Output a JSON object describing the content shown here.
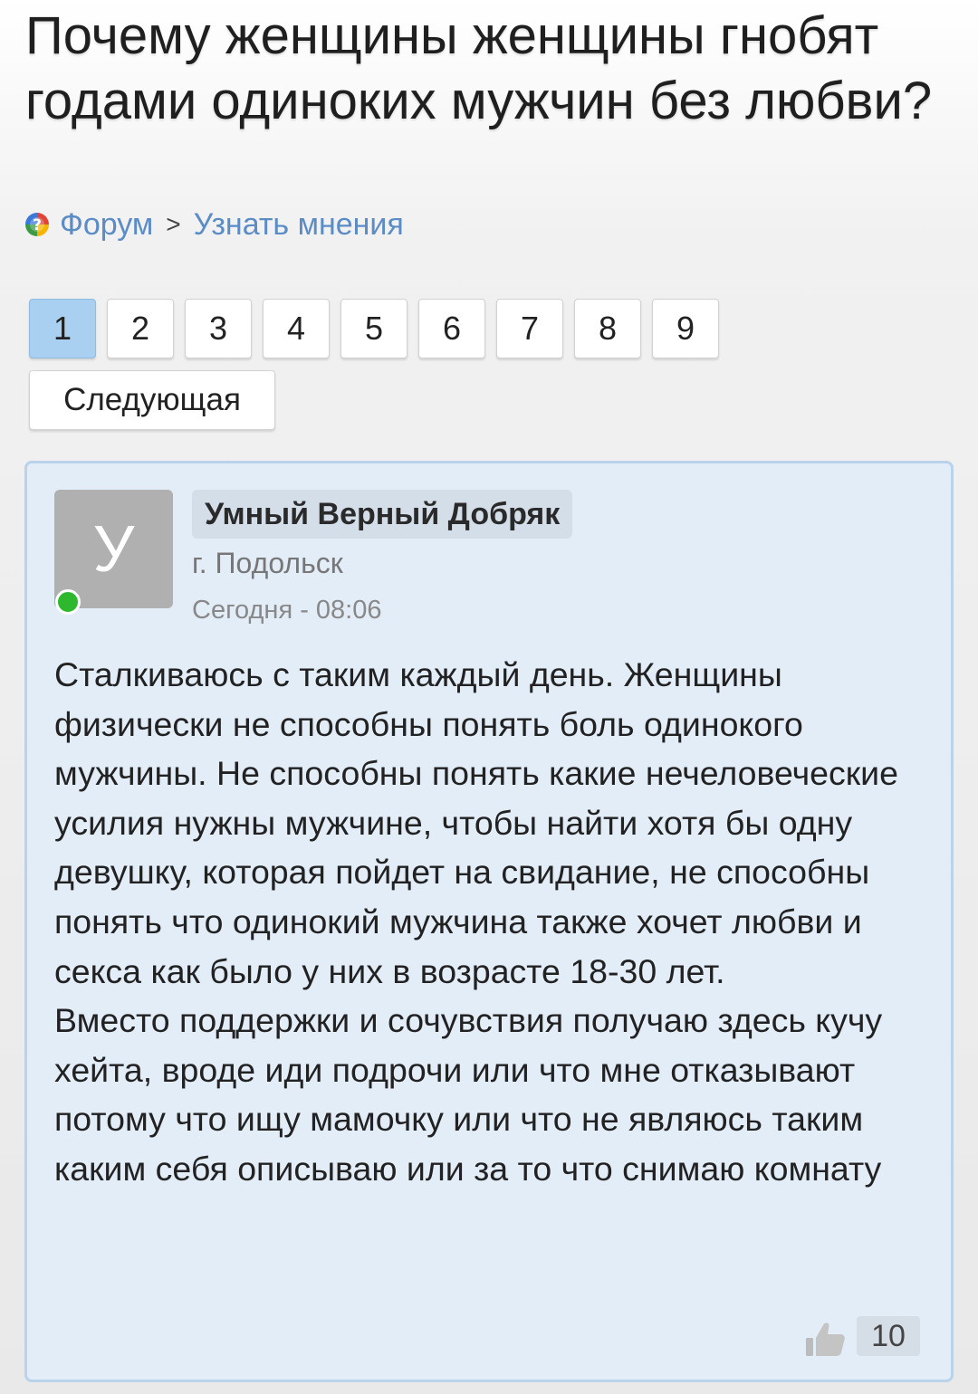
{
  "page": {
    "title": "Почему женщины женщины гнобят годами одиноких мужчин без любви?"
  },
  "breadcrumb": {
    "icon": "help-question-icon",
    "items": [
      "Форум",
      "Узнать мнения"
    ],
    "separator": ">"
  },
  "pagination": {
    "pages": [
      "1",
      "2",
      "3",
      "4",
      "5",
      "6",
      "7",
      "8",
      "9"
    ],
    "current": "1",
    "next_label": "Следующая"
  },
  "post": {
    "author": {
      "avatar_letter": "У",
      "name": "Умный Верный Добряк",
      "city": "г. Подольск",
      "online": true
    },
    "date": "Сегодня - 08:06",
    "text": "Сталкиваюсь с таким каждый день. Женщины физически не способны понять боль одинокого мужчины. Не способны понять какие нечеловеческие усилия нужны мужчине, чтобы найти хотя бы одну девушку, которая пойдет на свидание, не способны понять что одинокий мужчина также хочет любви и секса как было у них в возрасте 18-30 лет.\nВместо поддержки и сочувствия получаю здесь кучу хейта, вроде иди подрочи или что мне отказывают потому что ищу мамочку или что не являюсь таким каким себя описываю или за то что снимаю комнату",
    "likes": "10",
    "like_icon": "thumbs-up-icon"
  },
  "colors": {
    "link": "#5b8cc6",
    "active_page": "#a9d0f1",
    "post_background": "#e3edf8",
    "post_border": "#b9d3ea",
    "online": "#2eb82e"
  }
}
